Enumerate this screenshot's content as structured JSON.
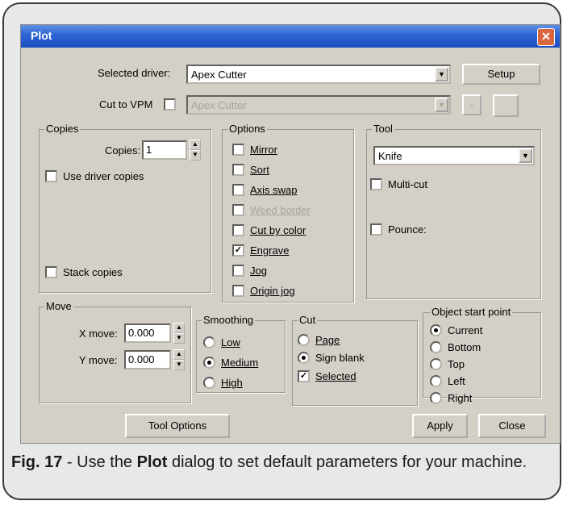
{
  "dialog": {
    "title": "Plot",
    "close_glyph": "✕",
    "selected_driver_label": "Selected driver:",
    "selected_driver_value": "Apex Cutter",
    "setup_button": "Setup",
    "cut_to_vpm_label": "Cut to VPM",
    "cut_to_vpm_checked": false,
    "vpm_value": "Apex Cutter",
    "copies_group": {
      "title": "Copies",
      "copies_label": "Copies:",
      "copies_value": "1",
      "use_driver_copies": "Use driver copies",
      "stack_copies": "Stack copies"
    },
    "options_group": {
      "title": "Options",
      "items": [
        {
          "label": "Mirror",
          "checked": false,
          "enabled": true
        },
        {
          "label": "Sort",
          "checked": false,
          "enabled": true
        },
        {
          "label": "Axis swap",
          "checked": false,
          "enabled": true
        },
        {
          "label": "Weed border",
          "checked": false,
          "enabled": false
        },
        {
          "label": "Cut by color",
          "checked": false,
          "enabled": true
        },
        {
          "label": "Engrave",
          "checked": true,
          "enabled": true
        },
        {
          "label": "Jog",
          "checked": false,
          "enabled": true
        },
        {
          "label": "Origin jog",
          "checked": false,
          "enabled": true
        }
      ]
    },
    "tool_group": {
      "title": "Tool",
      "tool_value": "Knife",
      "multi_cut": "Multi-cut",
      "pounce": "Pounce:"
    },
    "move_group": {
      "title": "Move",
      "x_label": "X move:",
      "x_value": "0.000",
      "y_label": "Y move:",
      "y_value": "0.000"
    },
    "smoothing_group": {
      "title": "Smoothing",
      "options": [
        "Low",
        "Medium",
        "High"
      ],
      "selected": "Medium"
    },
    "cut_group": {
      "title": "Cut",
      "page": "Page",
      "sign_blank": "Sign blank",
      "selected_label": "Selected",
      "selected_checked": true,
      "mode": "Sign blank"
    },
    "start_point_group": {
      "title": "Object start point",
      "options": [
        "Current",
        "Bottom",
        "Top",
        "Left",
        "Right"
      ],
      "selected": "Current"
    },
    "tool_options_button": "Tool Options",
    "apply_button": "Apply",
    "close_button": "Close"
  },
  "caption": {
    "fig": "Fig. 17",
    "text1": " - Use the ",
    "bold": "Plot",
    "text2": " dialog to set default parameters for your machine."
  }
}
